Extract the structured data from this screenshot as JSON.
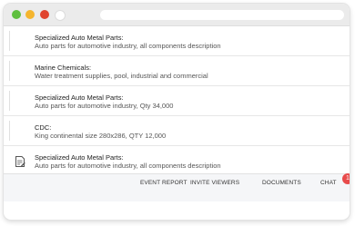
{
  "window": {
    "controls": [
      "green",
      "yellow",
      "red",
      "white"
    ],
    "colors": {
      "green": "#5fbf3e",
      "yellow": "#f5b52e",
      "red": "#e0442e"
    }
  },
  "feed": {
    "items": [
      {
        "title": "Specialized Auto Metal Parts:",
        "description": "Auto parts for automotive industry, all components description",
        "icon": ""
      },
      {
        "title": "Marine Chemicals:",
        "description": "Water treatment supplies, pool, industrial and commercial",
        "icon": ""
      },
      {
        "title": "Specialized Auto Metal Parts:",
        "description": "Auto parts for automotive industry, Qty 34,000",
        "icon": ""
      },
      {
        "title": "CDC:",
        "description": "King continental size 280x286, QTY 12,000",
        "icon": ""
      },
      {
        "title": "Specialized Auto Metal Parts:",
        "description": "Auto parts for automotive industry, all components description",
        "icon": "note-icon"
      }
    ]
  },
  "footer": {
    "event_report": "EVENT REPORT",
    "invite_viewers": "INVITE VIEWERS",
    "documents": "DOCUMENTS",
    "chat": "CHAT",
    "chat_badge": "1",
    "badge_color": "#e84b4b"
  }
}
